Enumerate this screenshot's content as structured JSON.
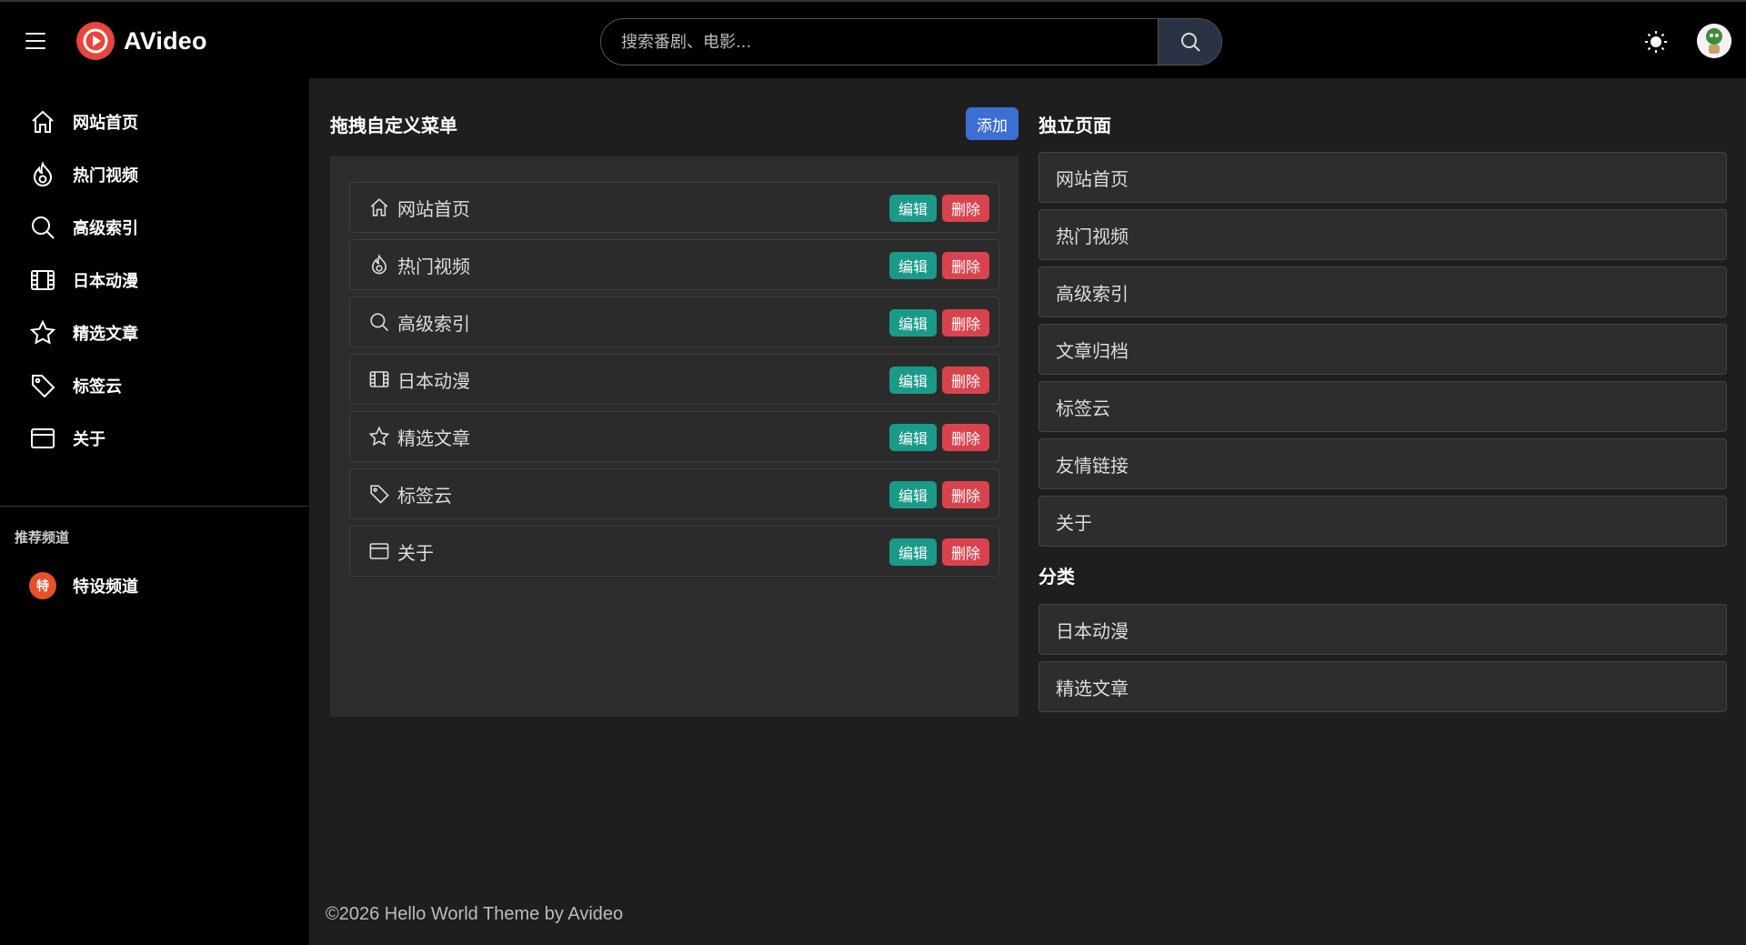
{
  "header": {
    "logo_text": "AVideo",
    "search_placeholder": "搜索番剧、电影..."
  },
  "sidebar": {
    "items": [
      {
        "label": "网站首页",
        "icon": "home-icon"
      },
      {
        "label": "热门视频",
        "icon": "fire-icon"
      },
      {
        "label": "高级索引",
        "icon": "search-icon"
      },
      {
        "label": "日本动漫",
        "icon": "film-icon"
      },
      {
        "label": "精选文章",
        "icon": "star-icon"
      },
      {
        "label": "标签云",
        "icon": "tag-icon"
      },
      {
        "label": "关于",
        "icon": "window-icon"
      }
    ],
    "section_label": "推荐频道",
    "channel": {
      "badge": "特",
      "label": "特设频道"
    }
  },
  "menu_panel": {
    "title": "拖拽自定义菜单",
    "add_label": "添加",
    "edit_label": "编辑",
    "delete_label": "删除",
    "items": [
      {
        "label": "网站首页",
        "icon": "home-icon"
      },
      {
        "label": "热门视频",
        "icon": "fire-icon"
      },
      {
        "label": "高级索引",
        "icon": "search-icon"
      },
      {
        "label": "日本动漫",
        "icon": "film-icon"
      },
      {
        "label": "精选文章",
        "icon": "star-icon"
      },
      {
        "label": "标签云",
        "icon": "tag-icon"
      },
      {
        "label": "关于",
        "icon": "window-icon"
      }
    ]
  },
  "pages_panel": {
    "title": "独立页面",
    "items": [
      "网站首页",
      "热门视频",
      "高级索引",
      "文章归档",
      "标签云",
      "友情链接",
      "关于"
    ]
  },
  "categories_panel": {
    "title": "分类",
    "items": [
      "日本动漫",
      "精选文章"
    ]
  },
  "footer": {
    "text": "©2026 Hello World Theme by Avideo"
  },
  "colors": {
    "add_button": "#3b6fd4",
    "edit_button": "#1a9a88",
    "delete_button": "#d9434d",
    "logo_red": "#e8453c"
  }
}
